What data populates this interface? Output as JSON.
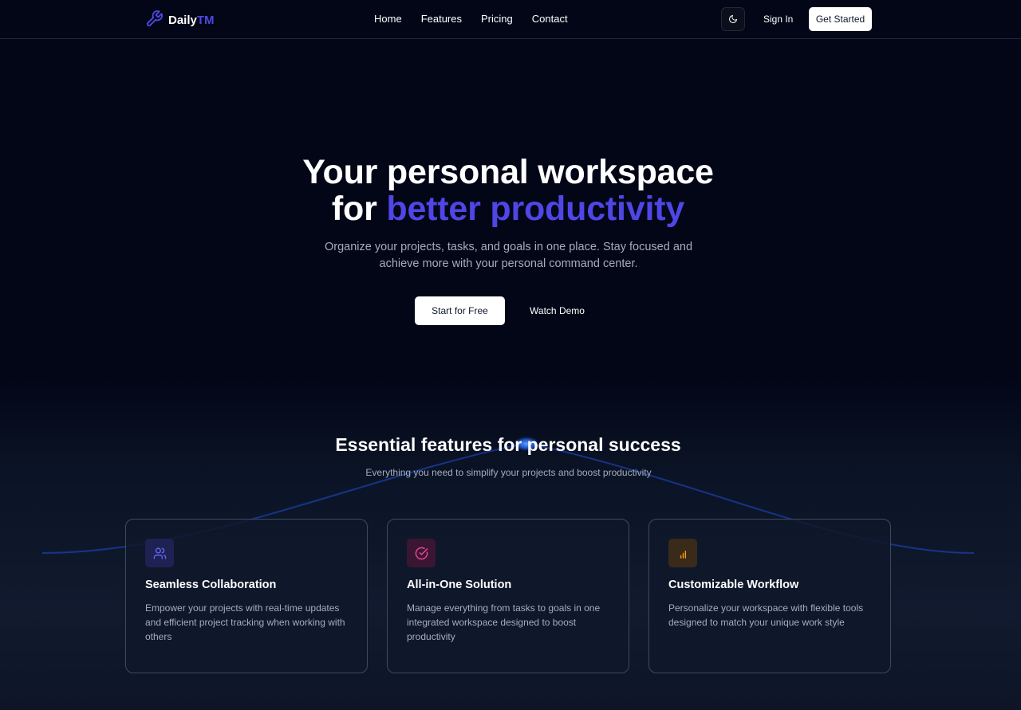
{
  "brand": {
    "name_main": "Daily",
    "name_accent": "TM",
    "icon": "wrench-icon",
    "accent_color": "#4f46e5"
  },
  "nav": {
    "items": [
      "Home",
      "Features",
      "Pricing",
      "Contact"
    ]
  },
  "header": {
    "theme_icon": "moon-icon",
    "sign_in": "Sign In",
    "get_started": "Get Started"
  },
  "hero": {
    "title_line1": "Your personal workspace",
    "title_line2_prefix": "for ",
    "title_line2_accent": "better productivity",
    "subtitle_line1": "Organize your projects, tasks, and goals in one place. Stay focused and",
    "subtitle_line2": "achieve more with your personal command center.",
    "primary_cta": "Start for Free",
    "secondary_cta": "Watch Demo"
  },
  "features": {
    "title": "Essential features for personal success",
    "subtitle": "Everything you need to simplify your projects and boost productivity",
    "cards": [
      {
        "icon": "users-icon",
        "icon_color": "#6366f1",
        "title": "Seamless Collaboration",
        "desc": "Empower your projects with real-time updates and efficient project tracking when working with others"
      },
      {
        "icon": "check-circle-icon",
        "icon_color": "#ec4899",
        "title": "All-in-One Solution",
        "desc": "Manage everything from tasks to goals in one integrated workspace designed to boost productivity"
      },
      {
        "icon": "bar-chart-icon",
        "icon_color": "#f59e0b",
        "title": "Customizable Workflow",
        "desc": "Personalize your workspace with flexible tools designed to match your unique work style"
      }
    ]
  }
}
